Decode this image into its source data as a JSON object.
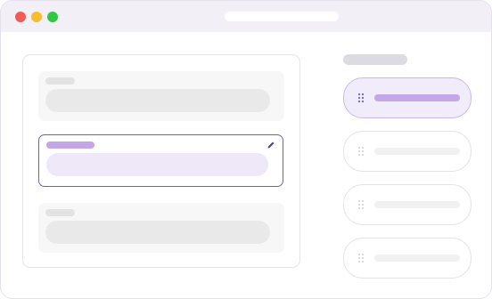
{
  "window": {
    "traffic_lights": [
      {
        "name": "close",
        "color": "#f05b55"
      },
      {
        "name": "minimize",
        "color": "#f6be2e"
      },
      {
        "name": "zoom",
        "color": "#2fc844"
      }
    ]
  },
  "colors": {
    "accent": "#6f5cc7",
    "accent_light": "#c3a6e6",
    "selected_fill": "#f1ecfa"
  },
  "form": {
    "fields": [
      {
        "state": "idle"
      },
      {
        "state": "active",
        "icon": "pencil-icon"
      },
      {
        "state": "idle"
      }
    ]
  },
  "sidebar": {
    "items": [
      {
        "state": "selected",
        "icon": "drag-handle-icon"
      },
      {
        "state": "default",
        "icon": "drag-handle-icon"
      },
      {
        "state": "default",
        "icon": "drag-handle-icon"
      },
      {
        "state": "default",
        "icon": "drag-handle-icon"
      }
    ]
  }
}
